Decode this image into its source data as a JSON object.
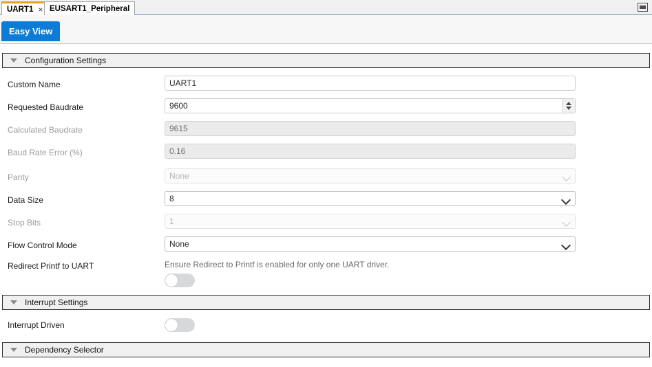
{
  "tabs": [
    {
      "label": "UART1",
      "active": true,
      "close_icon": "×"
    },
    {
      "label": "EUSART1_Peripheral",
      "active": false
    }
  ],
  "window": {
    "minimize_label": "minimize"
  },
  "toolbar": {
    "easy_view_label": "Easy View"
  },
  "sections": {
    "configuration": {
      "title": "Configuration Settings"
    },
    "interrupt": {
      "title": "Interrupt Settings"
    },
    "dependency": {
      "title": "Dependency Selector"
    }
  },
  "fields": {
    "custom_name": {
      "label": "Custom Name",
      "value": "UART1",
      "placeholder": ""
    },
    "requested_baudrate": {
      "label": "Requested Baudrate",
      "value": "9600",
      "placeholder": ""
    },
    "calculated_baudrate": {
      "label": "Calculated Baudrate",
      "value": "9615",
      "placeholder": ""
    },
    "baud_rate_error": {
      "label": "Baud Rate Error (%)",
      "value": "0.16",
      "placeholder": ""
    },
    "parity": {
      "label": "Parity",
      "value": "None"
    },
    "data_size": {
      "label": "Data Size",
      "value": "8"
    },
    "stop_bits": {
      "label": "Stop Bits",
      "value": "1"
    },
    "flow_control_mode": {
      "label": "Flow Control Mode",
      "value": "None"
    },
    "redirect_printf": {
      "label": "Redirect Printf to UART",
      "hint": "Ensure Redirect to Printf is enabled for only one UART driver.",
      "state": "off"
    },
    "interrupt_driven": {
      "label": "Interrupt Driven",
      "state": "off"
    }
  },
  "colors": {
    "accent_blue": "#0d7cd6",
    "tab_active_top": "#e8a020",
    "section_bg": "#f0f0f0",
    "readonly_bg": "#ebebeb"
  }
}
